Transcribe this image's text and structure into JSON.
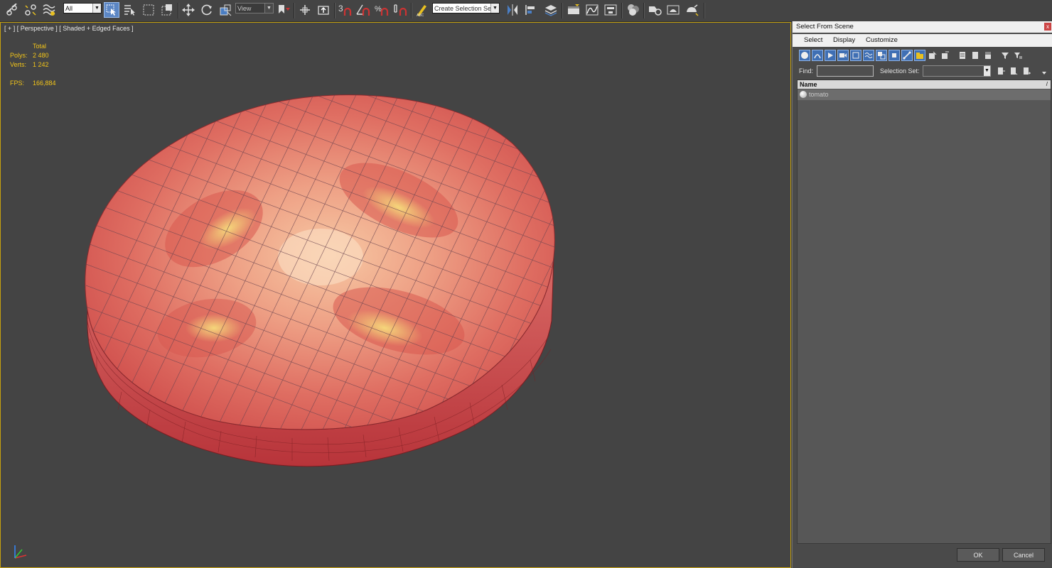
{
  "toolbar": {
    "selection_filter": "All",
    "reference_coordinate": "View",
    "named_selection_placeholder": "Create Selection Se"
  },
  "viewport": {
    "label": "[ + ] [ Perspective ] [ Shaded + Edged Faces ]",
    "stats": {
      "total_label": "Total",
      "polys_label": "Polys:",
      "polys_value": "2 480",
      "verts_label": "Verts:",
      "verts_value": "1 242",
      "fps_label": "FPS:",
      "fps_value": "166,884"
    },
    "accent_color": "#c7a20d"
  },
  "dialog": {
    "title": "Select From Scene",
    "close_glyph": "x",
    "menu": [
      "Select",
      "Display",
      "Customize"
    ],
    "find_label": "Find:",
    "find_value": "",
    "selection_set_label": "Selection Set:",
    "column_name": "Name",
    "sort_glyph": "/",
    "items": [
      {
        "name": "tomato",
        "icon": "sphere-object-icon",
        "selected": true
      }
    ],
    "ok_label": "OK",
    "cancel_label": "Cancel"
  }
}
